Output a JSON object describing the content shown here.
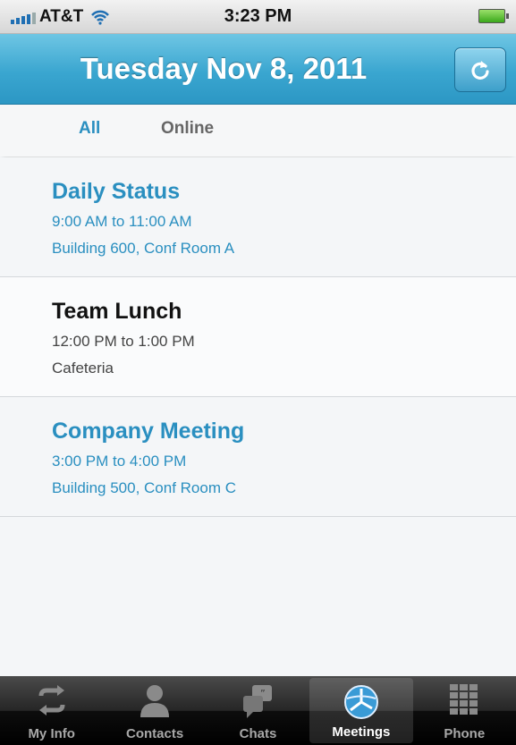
{
  "status_bar": {
    "carrier": "AT&T",
    "time": "3:23 PM"
  },
  "header": {
    "title": "Tuesday Nov 8, 2011",
    "refresh_icon": "refresh-icon"
  },
  "filters": [
    {
      "label": "All",
      "selected": true
    },
    {
      "label": "Online",
      "selected": false
    }
  ],
  "meetings": [
    {
      "title": "Daily Status",
      "time": "9:00 AM to 11:00 AM",
      "location": "Building 600, Conf Room A",
      "color": "#2a8fc0"
    },
    {
      "title": "Team Lunch",
      "time": "12:00 PM to 1:00 PM",
      "location": "Cafeteria",
      "color": "#111111"
    },
    {
      "title": "Company Meeting",
      "time": "3:00 PM to 4:00 PM",
      "location": "Building 500, Conf Room C",
      "color": "#2a8fc0"
    }
  ],
  "tabbar": [
    {
      "label": "My Info",
      "icon": "sync-icon",
      "active": false
    },
    {
      "label": "Contacts",
      "icon": "person-icon",
      "active": false
    },
    {
      "label": "Chats",
      "icon": "chat-bubbles-icon",
      "active": false
    },
    {
      "label": "Meetings",
      "icon": "meetings-globe-icon",
      "active": true
    },
    {
      "label": "Phone",
      "icon": "keypad-icon",
      "active": false
    }
  ],
  "colors": {
    "accent": "#2a8fc0",
    "header": "#3aa6d0"
  }
}
